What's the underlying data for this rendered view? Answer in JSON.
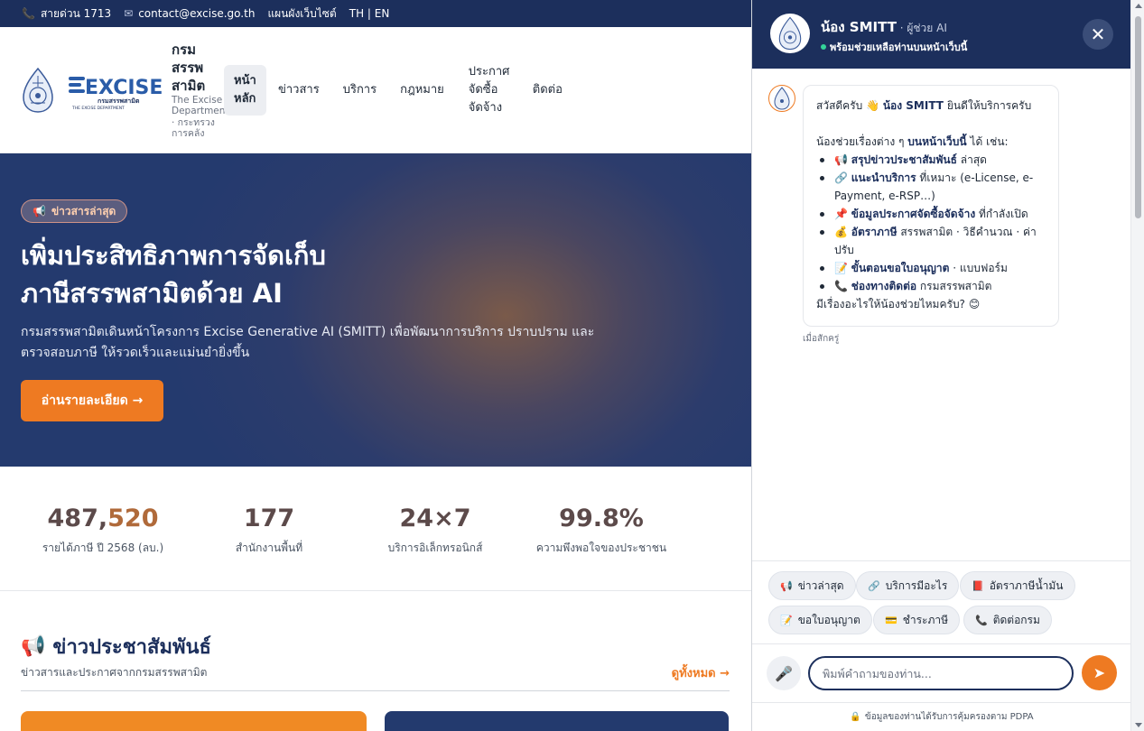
{
  "topbar": {
    "hotline": "สายด่วน 1713",
    "email": "contact@excise.go.th",
    "sitemap": "แผนผังเว็บไซต์",
    "lang": "TH | EN"
  },
  "header": {
    "logo_text": "EXCISE",
    "logo_sub_th": "กรมสรรพสามิต",
    "logo_sub_en": "THE EXCISE DEPARTMENT",
    "org_name": "กรมสรรพสามิต",
    "org_sub": "The Excise Department · กระทรวงการคลัง",
    "nav": [
      "หน้าหลัก",
      "ข่าวสาร",
      "บริการ",
      "กฎหมาย",
      "ประกาศจัดซื้อจัดจ้าง",
      "ติดต่อ"
    ]
  },
  "hero": {
    "badge_icon": "megaphone-icon",
    "badge": "ข่าวสารล่าสุด",
    "title_line1": "เพิ่มประสิทธิภาพการจัดเก็บ",
    "title_line2": "ภาษีสรรพสามิตด้วย AI",
    "description": "กรมสรรพสามิตเดินหน้าโครงการ Excise Generative AI (SMITT) เพื่อพัฒนาการบริการ ปราบปราม และตรวจสอบภาษี ให้รวดเร็วและแม่นยำยิ่งขึ้น",
    "button": "อ่านรายละเอียด →"
  },
  "stats": [
    {
      "value_main": "487,",
      "value_accent": "520",
      "label": "รายได้ภาษี ปี 2568 (ลบ.)"
    },
    {
      "value_main": "177",
      "value_accent": "",
      "label": "สำนักงานพื้นที่"
    },
    {
      "value_main": "24×7",
      "value_accent": "",
      "label": "บริการอิเล็กทรอนิกส์"
    },
    {
      "value_main": "99.8%",
      "value_accent": "",
      "label": "ความพึงพอใจของประชาชน"
    }
  ],
  "news": {
    "icon": "megaphone-icon",
    "title": "ข่าวประชาสัมพันธ์",
    "subtitle": "ข่าวสารและประกาศจากกรมสรรพสามิต",
    "view_all": "ดูทั้งหมด →"
  },
  "chat": {
    "name": "น้อง SMITT",
    "role": " · ผู้ช่วย AI",
    "status": "พร้อมช่วยเหลือท่านบนหน้าเว็บนี้",
    "message": {
      "greet_pre": "สวัสดีครับ 👋 ",
      "greet_name": "น้อง SMITT",
      "greet_post": " ยินดีให้บริการครับ",
      "intro_pre": "น้องช่วยเรื่องต่าง ๆ ",
      "intro_bold": "บนหน้าเว็บนี้",
      "intro_post": " ได้ เช่น:",
      "items": [
        {
          "icon": "📢 ",
          "bold": "สรุปข่าวประชาสัมพันธ์",
          "rest": " ล่าสุด"
        },
        {
          "icon": "🔗 ",
          "bold": "แนะนำบริการ",
          "rest": " ที่เหมาะ (e-License, e-Payment, e-RSP…)"
        },
        {
          "icon": "📌 ",
          "bold": "ข้อมูลประกาศจัดซื้อจัดจ้าง",
          "rest": " ที่กำลังเปิด"
        },
        {
          "icon": "💰 ",
          "bold": "อัตราภาษี",
          "rest": " สรรพสามิต · วิธีคำนวณ · ค่าปรับ"
        },
        {
          "icon": "📝 ",
          "bold": "ขั้นตอนขอใบอนุญาต",
          "rest": " · แบบฟอร์ม"
        },
        {
          "icon": "📞 ",
          "bold": "ช่องทางติดต่อ",
          "rest": " กรมสรรพสามิต"
        }
      ],
      "closing": "มีเรื่องอะไรให้น้องช่วยไหมครับ? 😊"
    },
    "time": "เมื่อสักครู่",
    "chips": [
      {
        "icon": "📢",
        "label": "ข่าวล่าสุด"
      },
      {
        "icon": "🔗",
        "label": "บริการมีอะไร"
      },
      {
        "icon": "📕",
        "label": "อัตราภาษีน้ำมัน"
      },
      {
        "icon": "📝",
        "label": "ขอใบอนุญาต"
      },
      {
        "icon": "💳",
        "label": "ชำระภาษี"
      },
      {
        "icon": "📞",
        "label": "ติดต่อกรม"
      }
    ],
    "input_placeholder": "พิมพ์คำถามของท่าน...",
    "pdpa": "ข้อมูลของท่านได้รับการคุ้มครองตาม PDPA"
  },
  "colors": {
    "navy": "#1c2f5c",
    "orange": "#ee7a22",
    "stat_text": "#5c4a4a",
    "stat_accent": "#b06a3a"
  }
}
